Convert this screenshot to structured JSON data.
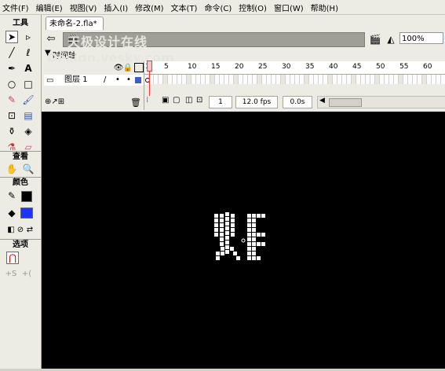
{
  "menubar": {
    "items": [
      "文件(F)",
      "编辑(E)",
      "视图(V)",
      "插入(I)",
      "修改(M)",
      "文本(T)",
      "命令(C)",
      "控制(O)",
      "窗口(W)",
      "帮助(H)"
    ]
  },
  "toolbox": {
    "tools_label": "工具",
    "view_label": "查看",
    "colors_label": "颜色",
    "options_label": "选项"
  },
  "document": {
    "tab_title": "未命名-2.fla*",
    "zoom": "100%"
  },
  "watermark": {
    "line1": "天极设计在线",
    "line2": "Design.yesky.com"
  },
  "timeline": {
    "label": "时间轴",
    "layer_name": "图层 1",
    "frame_ticks": [
      "1",
      "5",
      "10",
      "15",
      "20",
      "25",
      "30",
      "35",
      "40",
      "45",
      "50",
      "55",
      "60"
    ],
    "current_frame": "1",
    "frame_rate": "12.0 fps",
    "elapsed_time": "0.0s"
  },
  "colors": {
    "stage": "#000000",
    "playhead": "#ff3333",
    "layer_color": "#3a5fcd",
    "fill_swatch": "#1f33ff",
    "stroke_swatch": "#000000"
  }
}
